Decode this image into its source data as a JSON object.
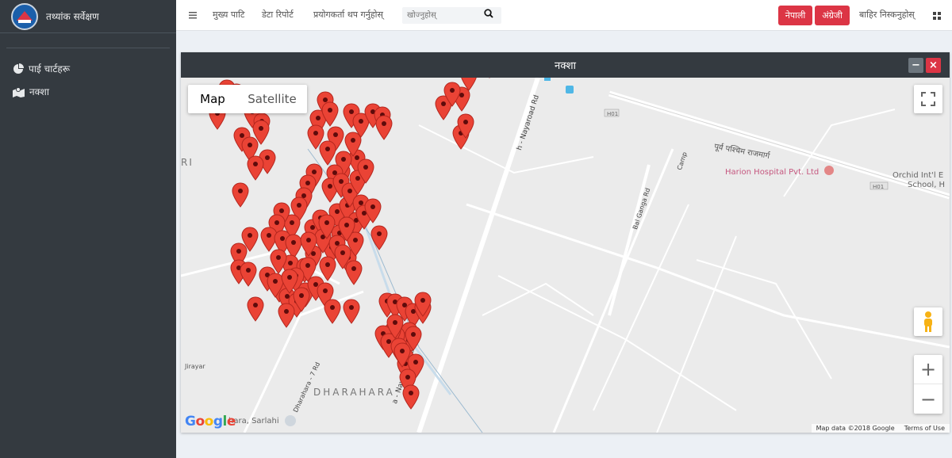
{
  "brand": {
    "title": "तथ्यांक सर्वेक्षण"
  },
  "sidebar": {
    "items": [
      {
        "label": "पाई चार्टहरू",
        "icon": "pie-chart-icon"
      },
      {
        "label": "नक्शा",
        "icon": "map-icon"
      }
    ]
  },
  "topnav": {
    "menu_icon": "hamburger-icon",
    "links": [
      "मुख्य पाटि",
      "डेटा रिपोर्ट",
      "प्रयोगकर्ता थप गर्नुहोस्"
    ],
    "search_placeholder": "खोज्नुहोस्",
    "search_icon": "search-icon"
  },
  "topright": {
    "nepali": "नेपाली",
    "english": "अंग्रेजी",
    "logout": "बाहिर निस्कनुहोस्",
    "grid_icon": "grid-icon"
  },
  "panel": {
    "title": "नक्शा",
    "minimize": "−",
    "close": "×",
    "accent": "#dc3545"
  },
  "map": {
    "type_map": "Map",
    "type_satellite": "Satellite",
    "zoom_in": "+",
    "zoom_out": "−",
    "labels": {
      "hospital": "Harion Hospital Pvt. Ltd",
      "orchid": "Orchid Int'l E",
      "school": "School, H",
      "highway1": "H01",
      "highway2": "H01",
      "purba": "पूर्व पश्चिम राजमार्ग",
      "dharahara": "DHARAHARA",
      "jirayar": "Jirayar",
      "ri": "RI",
      "sarlahi": "hara, Sarlahi",
      "nayaroad1": "a - Nayaroad Rd",
      "nayaroad2": "h - Nayaroad Rd",
      "balganga": "Bal Ganga Rd",
      "dharahara7": "Dharahara - 7 Rd",
      "camp": "Camp"
    },
    "attribution": {
      "data": "Map data ©2018 Google",
      "terms": "Terms of Use"
    },
    "google": "Google",
    "pin_color": "#ea4335"
  }
}
